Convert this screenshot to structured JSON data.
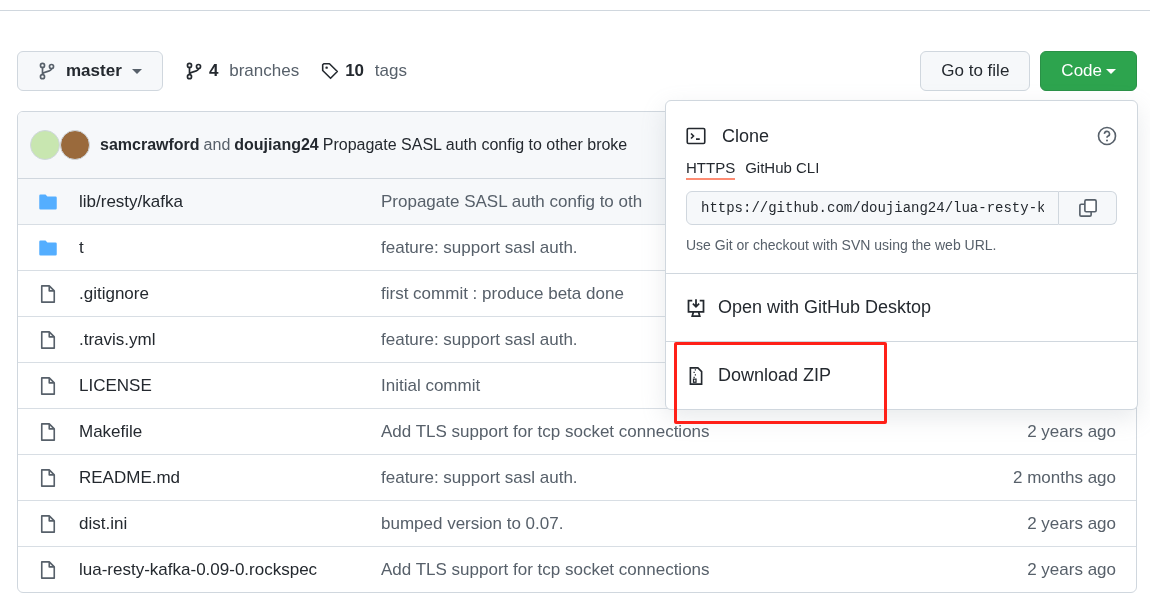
{
  "branch": {
    "name": "master"
  },
  "branches": {
    "count": "4",
    "label": "branches"
  },
  "tags": {
    "count": "10",
    "label": "tags"
  },
  "buttons": {
    "go_to_file": "Go to file",
    "code": "Code"
  },
  "commit": {
    "authors": [
      "samcrawford",
      "doujiang24"
    ],
    "conjunction": "and",
    "message": "Propagate SASL auth config to other broke"
  },
  "files": [
    {
      "kind": "folder",
      "name": "lib/resty/kafka",
      "message": "Propagate SASL auth config to oth"
    },
    {
      "kind": "folder",
      "name": "t",
      "message": "feature: support sasl auth."
    },
    {
      "kind": "file",
      "name": ".gitignore",
      "message": "first commit : produce beta done"
    },
    {
      "kind": "file",
      "name": ".travis.yml",
      "message": "feature: support sasl auth."
    },
    {
      "kind": "file",
      "name": "LICENSE",
      "message": "Initial commit"
    },
    {
      "kind": "file",
      "name": "Makefile",
      "message": "Add TLS support for tcp socket connections",
      "age": "2 years ago"
    },
    {
      "kind": "file",
      "name": "README.md",
      "message": "feature: support sasl auth.",
      "age": "2 months ago"
    },
    {
      "kind": "file",
      "name": "dist.ini",
      "message": "bumped version to 0.07.",
      "age": "2 years ago"
    },
    {
      "kind": "file",
      "name": "lua-resty-kafka-0.09-0.rockspec",
      "message": "Add TLS support for tcp socket connections",
      "age": "2 years ago"
    }
  ],
  "clone_menu": {
    "title": "Clone",
    "tabs": [
      {
        "label": "HTTPS",
        "selected": true
      },
      {
        "label": "GitHub CLI",
        "selected": false
      }
    ],
    "url": "https://github.com/doujiang24/lua-resty-k",
    "hint": "Use Git or checkout with SVN using the web URL.",
    "items": [
      {
        "kind": "desktop",
        "label": "Open with GitHub Desktop",
        "highlighted": false
      },
      {
        "kind": "zip",
        "label": "Download ZIP",
        "highlighted": true
      }
    ]
  }
}
